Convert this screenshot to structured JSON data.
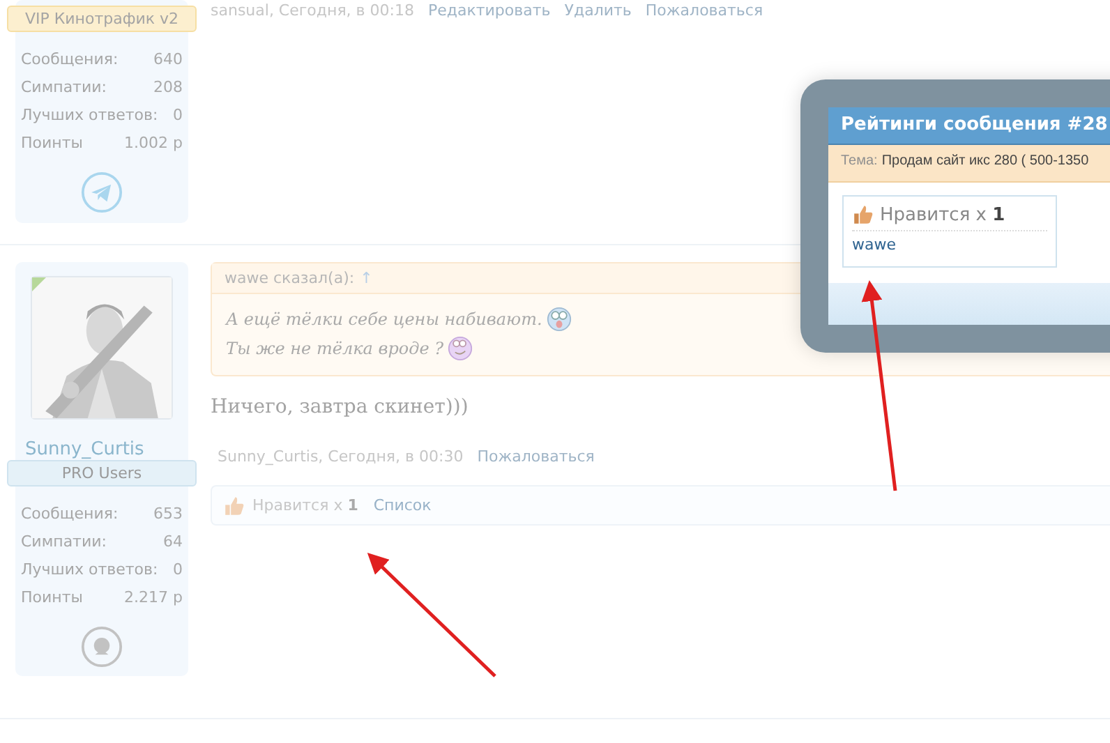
{
  "posts": [
    {
      "badge": "VIP Кинотрафик v2",
      "stats": [
        {
          "label": "Сообщения:",
          "value": "640"
        },
        {
          "label": "Симпатии:",
          "value": "208"
        },
        {
          "label": "Лучших ответов:",
          "value": "0"
        },
        {
          "label": "Поинты",
          "value": "1.002 р"
        }
      ],
      "meta": "sansual, Сегодня, в 00:18",
      "actions": [
        "Редактировать",
        "Удалить",
        "Пожаловаться"
      ]
    },
    {
      "author": "Sunny_Curtis",
      "badge": "PRO Users",
      "stats": [
        {
          "label": "Сообщения:",
          "value": "653"
        },
        {
          "label": "Симпатии:",
          "value": "64"
        },
        {
          "label": "Лучших ответов:",
          "value": "0"
        },
        {
          "label": "Поинты",
          "value": "2.217 р"
        }
      ],
      "quote": {
        "author": "wawe сказал(а):",
        "jump": "↑",
        "lines": [
          "А ещё тёлки себе цены набивают.",
          "Ты же не тёлка вроде ?"
        ]
      },
      "message": "Ничего, завтра скинет)))",
      "meta": "Sunny_Curtis, Сегодня, в 00:30",
      "actions": [
        "Пожаловаться"
      ],
      "likes": {
        "text": "Нравится x",
        "count": "1",
        "link": "Список"
      }
    }
  ],
  "modal": {
    "title": "Рейтинги сообщения #28",
    "topic_label": "Тема:",
    "topic": "Продам сайт икс 280 ( 500-1350",
    "rating": {
      "text": "Нравится x",
      "count": "1",
      "users": [
        "wawe"
      ]
    }
  }
}
